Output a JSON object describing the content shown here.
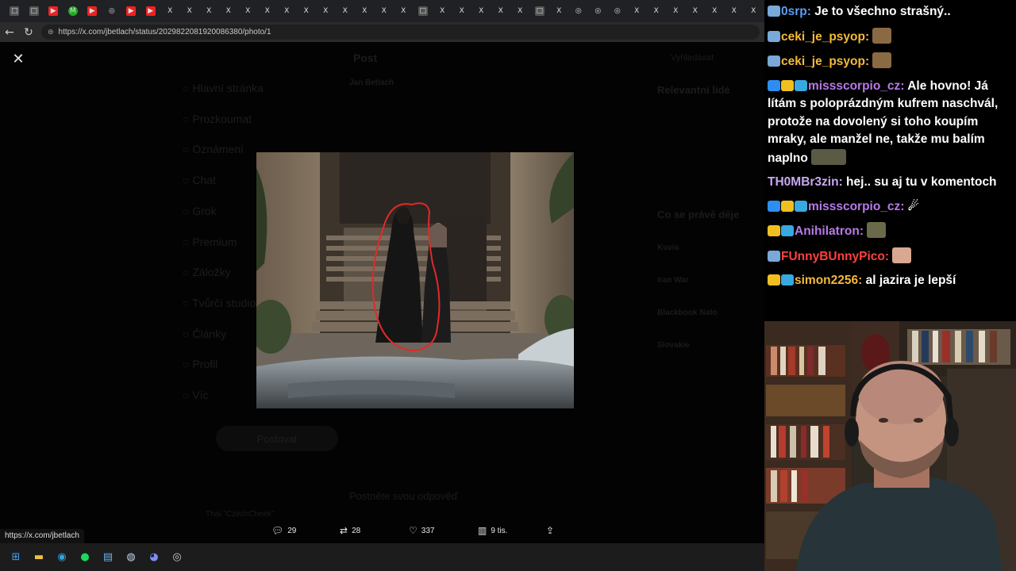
{
  "browser": {
    "tabs": [
      "□",
      "□",
      "▶",
      "M",
      "▶",
      "◎",
      "▶",
      "▶",
      "X",
      "X",
      "X",
      "X",
      "X",
      "X",
      "X",
      "X",
      "X",
      "X",
      "X",
      "X",
      "X",
      "□",
      "X",
      "X",
      "X",
      "X",
      "X",
      "□",
      "X",
      "◎",
      "◎",
      "◎",
      "X",
      "X",
      "X",
      "X",
      "X",
      "X",
      "X",
      "X",
      "X",
      "X"
    ],
    "url": "https://x.com/jbetlach/status/2029822081920086380/photo/1"
  },
  "x_page": {
    "nav_items": [
      "Hlavní stránka",
      "Prozkoumat",
      "Oznámení",
      "Chat",
      "Grok",
      "Premium",
      "Záložky",
      "Tvůrčí studio",
      "Články",
      "Profil",
      "Víc"
    ],
    "post_button": "Postovat",
    "header": "Post",
    "author": "Jan Betlach",
    "search_placeholder": "Vyhledávat",
    "right_headings": [
      "Relevantní lidé",
      "Co se právě děje"
    ],
    "trends": [
      "Kuvia",
      "Iran War",
      "Blackbook Nato",
      "Slovakie"
    ],
    "account_preview": "Thai \"CzechCheek\"",
    "reply_placeholder": "Postněte svou odpověď"
  },
  "actions": {
    "replies": "29",
    "reposts": "28",
    "likes": "337",
    "views": "9 tis."
  },
  "status_url": "https://x.com/jbetlach",
  "taskbar_icons": [
    "windows-icon",
    "file-explorer-icon",
    "edge-icon",
    "spotify-icon",
    "notepad-icon",
    "steam-icon",
    "discord-icon",
    "chrome-icon"
  ],
  "chat": [
    {
      "user": "0srp",
      "color": "#5b9cf5",
      "badges": [
        "#7aa8d8"
      ],
      "text": "Je to všechno strašný.."
    },
    {
      "user": "ceki_je_psyop",
      "color": "#f5b93a",
      "badges": [
        "#7aa8d8"
      ],
      "text": "",
      "emote": "#8a6a45"
    },
    {
      "user": "ceki_je_psyop",
      "color": "#f5b93a",
      "badges": [
        "#7aa8d8"
      ],
      "text": "",
      "emote": "#8a6a45"
    },
    {
      "user": "missscorpio_cz",
      "color": "#b77ae8",
      "badges": [
        "#2e8ef0",
        "#f0c020",
        "#38a8e0"
      ],
      "text": "Ale hovno! Já lítám s poloprázdným kufrem naschvál, protože na dovolený si toho koupím mraky, ale manžel ne, takže mu balím naplno",
      "emote": "#5a5a45"
    },
    {
      "user": "TH0MBr3zin",
      "color": "#c7a9f0",
      "badges": [],
      "text": "hej.. su aj tu v komentoch"
    },
    {
      "user": "missscorpio_cz",
      "color": "#b77ae8",
      "badges": [
        "#2e8ef0",
        "#f0c020",
        "#38a8e0"
      ],
      "text": "☄"
    },
    {
      "user": "Anihilatron",
      "color": "#b77ae8",
      "badges": [
        "#f0c020",
        "#38a8e0"
      ],
      "text": "",
      "emote": "#6a6a4a"
    },
    {
      "user": "FUnnyBUnnyPico",
      "color": "#ff4040",
      "badges": [
        "#7aa8d8"
      ],
      "text": "",
      "emote": "#d8a890"
    },
    {
      "user": "simon2256",
      "color": "#f5b93a",
      "badges": [
        "#f0c020",
        "#38a8e0"
      ],
      "text": "al jazira je lepší"
    }
  ]
}
